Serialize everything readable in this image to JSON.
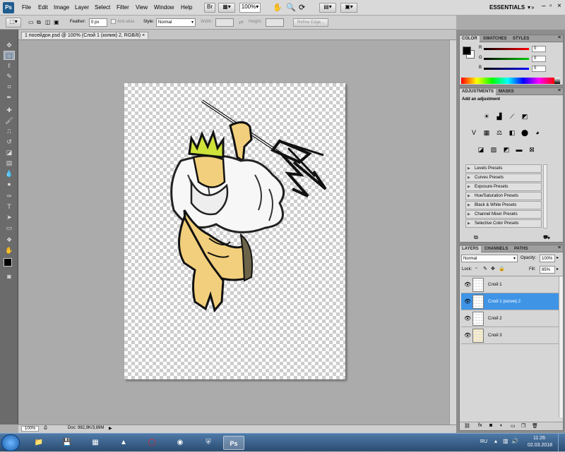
{
  "app": {
    "logo": "Ps",
    "menu": [
      "File",
      "Edit",
      "Image",
      "Layer",
      "Select",
      "Filter",
      "View",
      "Window",
      "Help"
    ],
    "zoom_dropdown": "100%",
    "workspace": "ESSENTIALS",
    "workspace_arrow": "▾",
    "cs_live": "CS Live"
  },
  "options_bar": {
    "feather_label": "Feather:",
    "feather_value": "0 px",
    "antialias_label": "Anti-alias",
    "style_label": "Style:",
    "style_value": "Normal",
    "width_label": "Width:",
    "height_label": "Height:",
    "refine_edge": "Refine Edge..."
  },
  "document": {
    "tab_title": "1 посейдон.psd @ 100% (Слой 1 (копия) 2, RGB/8)",
    "tab_close": "×",
    "zoom": "100%",
    "doc_info": "Doc: 982,9K/3,89M"
  },
  "color_panel": {
    "tabs": [
      "COLOR",
      "SWATCHES",
      "STYLES"
    ],
    "channels": [
      {
        "label": "R",
        "value": "0",
        "color": "#d21414"
      },
      {
        "label": "G",
        "value": "0",
        "color": "#1a9c1a"
      },
      {
        "label": "B",
        "value": "0",
        "color": "#1a1ac8"
      }
    ]
  },
  "adjustments_panel": {
    "tabs": [
      "ADJUSTMENTS",
      "MASKS"
    ],
    "heading": "Add an adjustment",
    "presets": [
      "Levels Presets",
      "Curves Presets",
      "Exposure Presets",
      "Hue/Saturation Presets",
      "Black & White Presets",
      "Channel Mixer Presets",
      "Selective Color Presets"
    ]
  },
  "layers_panel": {
    "tabs": [
      "LAYERS",
      "CHANNELS",
      "PATHS"
    ],
    "blend_mode": "Normal",
    "opacity_label": "Opacity:",
    "opacity": "100%",
    "lock_label": "Lock:",
    "fill_label": "Fill:",
    "fill": "85%",
    "layers": [
      {
        "name": "Слой 1",
        "selected": false
      },
      {
        "name": "Слой 1 (копия) 2",
        "selected": true
      },
      {
        "name": "Слой 2",
        "selected": false
      },
      {
        "name": "Слой 3",
        "selected": false
      }
    ]
  },
  "taskbar": {
    "lang": "RU",
    "time": "11:26",
    "date": "02.03.2018"
  },
  "colors": {
    "selection": "#3f94e6",
    "skin": "#f2cf7c",
    "crown": "#cfe23a"
  }
}
